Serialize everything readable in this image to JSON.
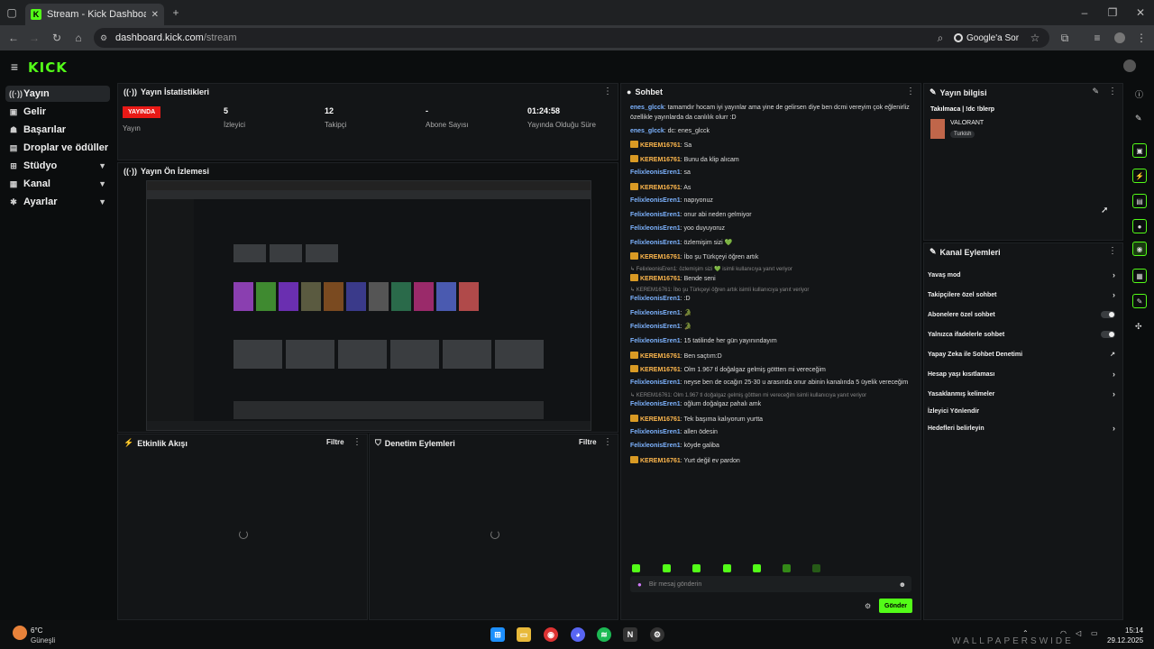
{
  "browser": {
    "tab_title": "Stream - Kick Dashboard",
    "url_host": "dashboard.kick.com",
    "url_path": "/stream",
    "google_button": "Google'a Sor"
  },
  "brand": {
    "logo": "KICK"
  },
  "sidebar": {
    "items": [
      {
        "label": "Yayın",
        "icon": "broadcast-icon"
      },
      {
        "label": "Gelir",
        "icon": "revenue-icon"
      },
      {
        "label": "Başarılar",
        "icon": "achievement-icon"
      },
      {
        "label": "Droplar ve ödüller",
        "icon": "gift-icon"
      },
      {
        "label": "Stüdyo",
        "icon": "studio-icon"
      },
      {
        "label": "Kanal",
        "icon": "channel-icon"
      },
      {
        "label": "Ayarlar",
        "icon": "settings-icon"
      }
    ]
  },
  "stats": {
    "title": "Yayın İstatistikleri",
    "live_badge": "YAYINDA",
    "stream_label": "Yayın",
    "viewers_value": "5",
    "viewers_label": "İzleyici",
    "followers_value": "12",
    "followers_label": "Takipçi",
    "subs_value": "-",
    "subs_label": "Abone Sayısı",
    "uptime_value": "01:24:58",
    "uptime_label": "Yayında Olduğu Süre"
  },
  "preview": {
    "title": "Yayın Ön İzlemesi"
  },
  "activity": {
    "title": "Etkinlik Akışı",
    "filter": "Filtre"
  },
  "moderation": {
    "title": "Denetim Eylemleri",
    "filter": "Filtre"
  },
  "chat": {
    "title": "Sohbet",
    "input_placeholder": "Bir mesaj gönderin",
    "send_label": "Gönder",
    "messages": [
      {
        "user": "enes_glcck",
        "text": ": tamamdır hocam iyi yayınlar ama yine de gelirsen diye ben dcmi vereyim çok eğlenirliz",
        "color": "blue",
        "crown": false
      },
      {
        "user": "",
        "text": "özellikle yayınlarda da canlılık olurr :D",
        "color": "blue",
        "crown": false
      },
      {
        "user": "enes_glcck",
        "text": ": dc: enes_glcck",
        "color": "blue",
        "crown": false
      },
      {
        "user": "KEREM16761",
        "text": ": Sa",
        "color": "gold",
        "crown": true
      },
      {
        "user": "KEREM16761",
        "text": ": Bunu da klip alıcam",
        "color": "gold",
        "crown": true
      },
      {
        "user": "FelixleonisEren1",
        "text": ": sa",
        "color": "blue",
        "crown": false
      },
      {
        "user": "KEREM16761",
        "text": ": As",
        "color": "gold",
        "crown": true
      },
      {
        "user": "FelixleonisEren1",
        "text": ": napıyonuz",
        "color": "blue",
        "crown": false
      },
      {
        "user": "FelixleonisEren1",
        "text": ": onur abi neden gelmiyor",
        "color": "blue",
        "crown": false
      },
      {
        "user": "FelixleonisEren1",
        "text": ": yoo duyuyoruz",
        "color": "blue",
        "crown": false
      },
      {
        "user": "FelixleonisEren1",
        "text": ": özlemişim sizi 💚",
        "color": "blue",
        "crown": false
      },
      {
        "user": "KEREM16761",
        "text": ": İbo şu Türkçeyi öğren artık",
        "color": "gold",
        "crown": true
      },
      {
        "user": "KEREM16761",
        "text": ": Bende seni",
        "color": "gold",
        "crown": true
      },
      {
        "user": "FelixleonisEren1",
        "text": ": :D",
        "color": "blue",
        "crown": false
      },
      {
        "user": "FelixleonisEren1",
        "text": ": 🐊",
        "color": "blue",
        "crown": false
      },
      {
        "user": "FelixleonisEren1",
        "text": ": 🐊",
        "color": "blue",
        "crown": false
      },
      {
        "user": "FelixleonisEren1",
        "text": ": 15 tatilinde her gün yayınındayım",
        "color": "blue",
        "crown": false
      },
      {
        "user": "KEREM16761",
        "text": ": Ben saçtım:D",
        "color": "gold",
        "crown": true
      },
      {
        "user": "KEREM16761",
        "text": ": Olm 1.967 tl doğalgaz gelmiş göttten mi vereceğim",
        "color": "gold",
        "crown": true
      },
      {
        "user": "FelixleonisEren1",
        "text": ": neyse ben de ocağın 25-30 u arasında onur abinin kanalında 5 üyelik vereceğim",
        "color": "blue",
        "crown": false
      },
      {
        "user": "FelixleonisEren1",
        "text": ": oğlum doğalgaz pahalı amk",
        "color": "blue",
        "crown": false
      },
      {
        "user": "KEREM16761",
        "text": ": Tek başıma kalıyorum yurtta",
        "color": "gold",
        "crown": true
      },
      {
        "user": "FelixleonisEren1",
        "text": ": allen ödesin",
        "color": "blue",
        "crown": false
      },
      {
        "user": "FelixleonisEren1",
        "text": ": köyde galiba",
        "color": "blue",
        "crown": false
      },
      {
        "user": "KEREM16761",
        "text": ": Yurt değil ev pardon",
        "color": "gold",
        "crown": true
      }
    ],
    "replies": [
      "↳ FelixleonisEren1: özlemişim sizi 💚 isimli kullanıcıya yanıt veriyor",
      "↳ KEREM16761: İbo şu Türkçeyi öğren artık isimli kullanıcıya yanıt veriyor",
      "↳ KEREM16761: Olm 1.967 tl doğalgaz gelmiş göttten mi vereceğim isimli kullanıcıya yanıt veriyor"
    ]
  },
  "stream_info": {
    "title": "Yayın bilgisi",
    "stream_title": "Takılmaca | !dc !blerp",
    "game": "VALORANT",
    "tag": "Turkish"
  },
  "channel_actions": {
    "title": "Kanal Eylemleri",
    "items": [
      {
        "label": "Yavaş mod",
        "control": "arrow"
      },
      {
        "label": "Takipçilere özel sohbet",
        "control": "arrow"
      },
      {
        "label": "Abonelere özel sohbet",
        "control": "toggle"
      },
      {
        "label": "Yalnızca ifadelerle sohbet",
        "control": "toggle"
      },
      {
        "label": "Yapay Zeka ile Sohbet Denetimi",
        "control": "external"
      },
      {
        "label": "Hesap yaşı kısıtlaması",
        "control": "arrow"
      },
      {
        "label": "Yasaklanmış kelimeler",
        "control": "arrow"
      },
      {
        "label": "İzleyici Yönlendir",
        "control": "none"
      },
      {
        "label": "Hedefleri belirleyin",
        "control": "arrow"
      }
    ]
  },
  "taskbar": {
    "weather_temp": "6°C",
    "weather_desc": "Güneşli",
    "time": "15:14",
    "date": "29.12.2025"
  },
  "watermark": "WALLPAPERSWIDE",
  "colors": {
    "accent": "#53fc18",
    "live": "#e91916",
    "user_blue": "#7db3ff",
    "user_gold": "#ffb84d"
  }
}
